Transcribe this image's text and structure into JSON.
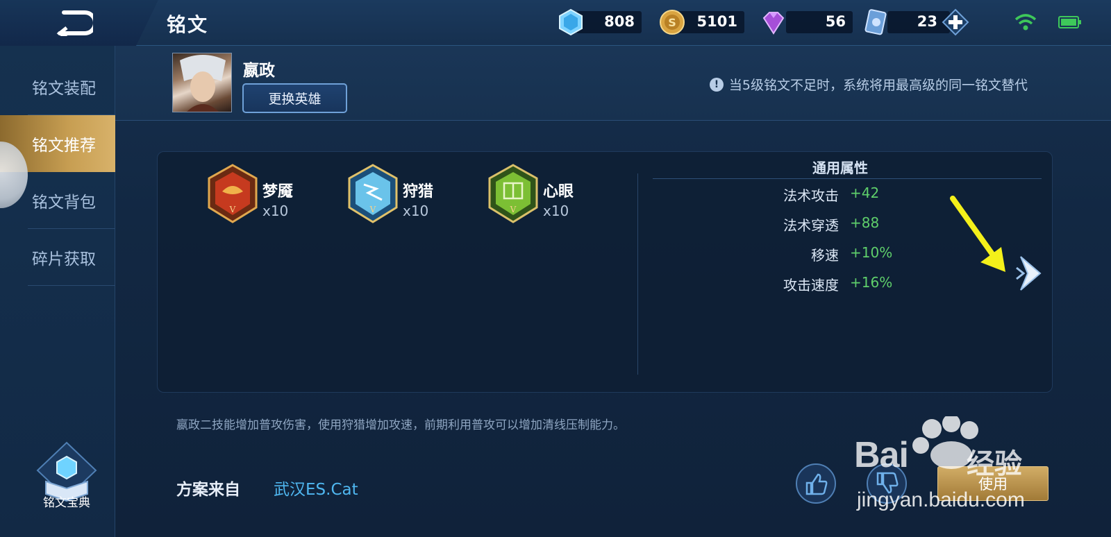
{
  "header": {
    "title": "铭文",
    "resources": [
      {
        "icon": "crystal-icon",
        "value": "808"
      },
      {
        "icon": "gold-coin-icon",
        "value": "5101"
      },
      {
        "icon": "diamond-icon",
        "value": "56"
      },
      {
        "icon": "ticket-icon",
        "value": "23"
      }
    ]
  },
  "sidebar": {
    "items": [
      {
        "label": "铭文装配",
        "active": false
      },
      {
        "label": "铭文推荐",
        "active": true
      },
      {
        "label": "铭文背包",
        "active": false
      },
      {
        "label": "碎片获取",
        "active": false
      }
    ],
    "dex_label": "铭文宝典"
  },
  "hero": {
    "name": "嬴政",
    "change_button": "更换英雄"
  },
  "notice": "当5级铭文不足时，系统将用最高级的同一铭文替代",
  "runes": [
    {
      "name": "梦魇",
      "count": "x10",
      "color": "#c0392b"
    },
    {
      "name": "狩猎",
      "count": "x10",
      "color": "#3b8fc4"
    },
    {
      "name": "心眼",
      "count": "x10",
      "color": "#6aa52f"
    }
  ],
  "attributes": {
    "title": "通用属性",
    "rows": [
      {
        "name": "法术攻击",
        "value": "+42"
      },
      {
        "name": "法术穿透",
        "value": "+88"
      },
      {
        "name": "移速",
        "value": "+10%"
      },
      {
        "name": "攻击速度",
        "value": "+16%"
      }
    ]
  },
  "description": "嬴政二技能增加普攻伤害，使用狩猎增加攻速，前期利用普攻可以增加清线压制能力。",
  "source": {
    "label": "方案来自",
    "author": "武汉ES.Cat"
  },
  "actions": {
    "use_label": "使用"
  },
  "watermark": {
    "brand": "Bai",
    "cn": "经验",
    "url": "jingyan.baidu.com"
  },
  "colors": {
    "accent_gold": "#c79e52",
    "positive_green": "#5fcf6b",
    "link_blue": "#4fb7f0"
  }
}
